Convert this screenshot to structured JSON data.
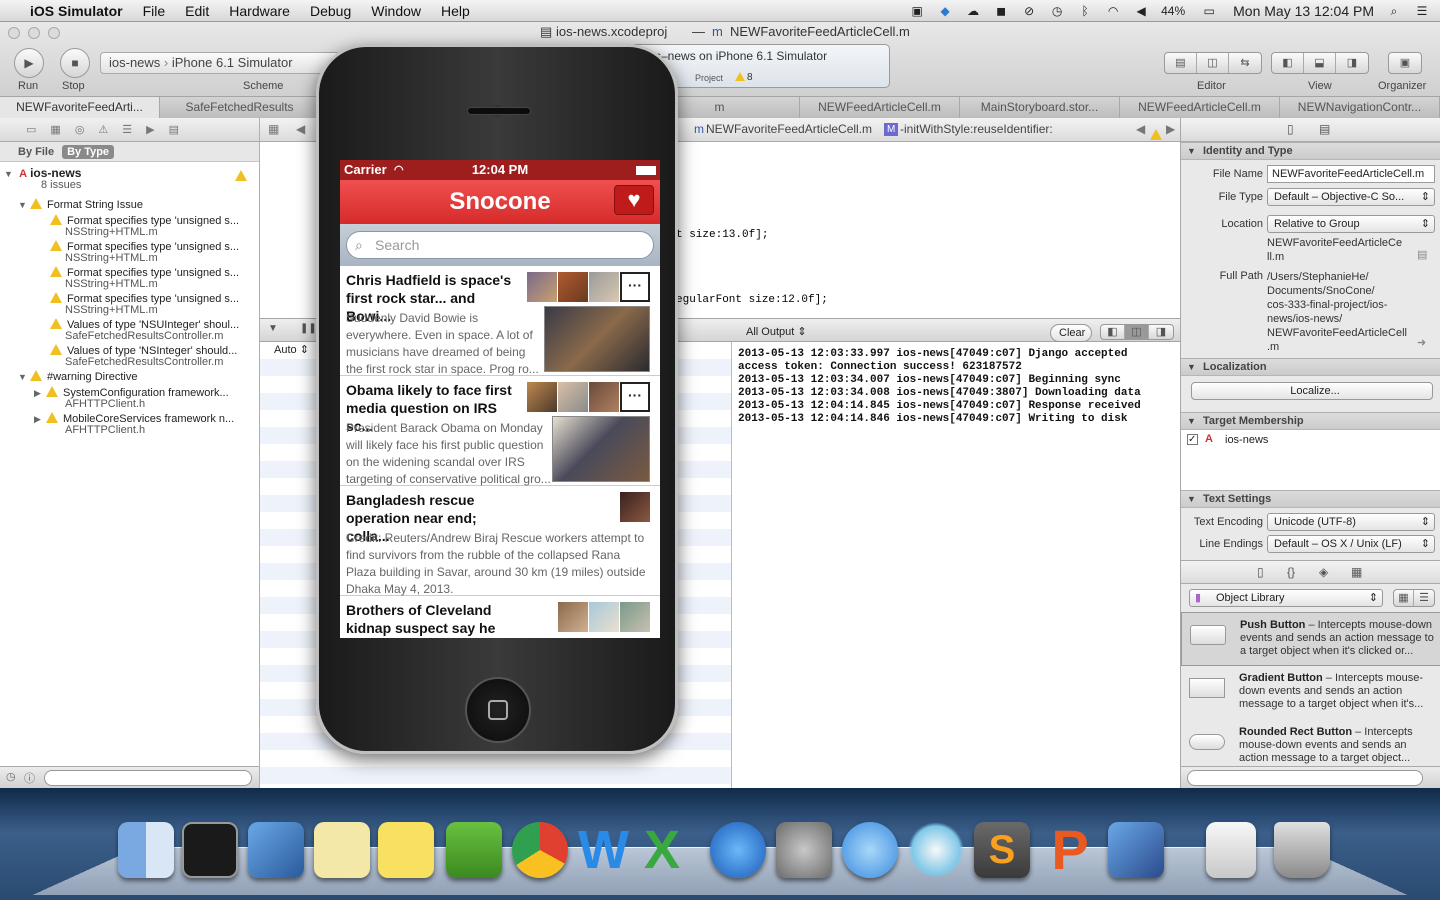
{
  "menubar": {
    "apple": "",
    "app_name": "iOS Simulator",
    "items": [
      "File",
      "Edit",
      "Hardware",
      "Debug",
      "Window",
      "Help"
    ],
    "battery": "44%",
    "clock": "Mon May 13  12:04 PM"
  },
  "window": {
    "title_left": "ios-news.xcodeproj",
    "title_sep": "—",
    "title_right": "NEWFavoriteFeedArticleCell.m",
    "run_label": "Run",
    "stop_label": "Stop",
    "scheme_project": "ios-news",
    "scheme_device": "iPhone 6.1 Simulator",
    "scheme_label": "Scheme",
    "activity_text": "s–news on iPhone 6.1 Simulator",
    "activity_project": "Project",
    "activity_warnings": "8",
    "editor_label": "Editor",
    "view_label": "View",
    "organizer_label": "Organizer"
  },
  "tabs": [
    "NEWFavoriteFeedArti...",
    "SafeFetchedResults",
    "",
    "",
    "m",
    "NEWFeedArticleCell.m",
    "MainStoryboard.stor...",
    "NEWFeedArticleCell.m",
    "NEWNavigationContr..."
  ],
  "navigator": {
    "by_file": "By File",
    "by_type": "By Type",
    "project": "ios-news",
    "project_sub": "8 issues",
    "group1": "Format String Issue",
    "group2": "#warning Directive",
    "issues": [
      {
        "title": "Format specifies type 'unsigned s...",
        "file": "NSString+HTML.m"
      },
      {
        "title": "Format specifies type 'unsigned s...",
        "file": "NSString+HTML.m"
      },
      {
        "title": "Format specifies type 'unsigned s...",
        "file": "NSString+HTML.m"
      },
      {
        "title": "Format specifies type 'unsigned s...",
        "file": "NSString+HTML.m"
      },
      {
        "title": "Values of type 'NSUInteger' shoul...",
        "file": "SafeFetchedResultsController.m"
      },
      {
        "title": "Values of type 'NSInteger' should...",
        "file": "SafeFetchedResultsController.m"
      }
    ],
    "directives": [
      {
        "title": "SystemConfiguration framework...",
        "file": "AFHTTPClient.h"
      },
      {
        "title": "MobileCoreServices framework n...",
        "file": "AFHTTPClient.h"
      }
    ]
  },
  "editor": {
    "jump_file": "NEWFavoriteFeedArticleCell.m",
    "jump_method": "-initWithStyle:reuseIdentifier:",
    "code1": "t size:13.0f];",
    "code2": "egularFont size:12.0f];",
    "auto_label": "Auto",
    "output_label": "All Output",
    "clear_label": "Clear",
    "console": "2013-05-13 12:03:33.997 ios-news[47049:c07] Django accepted\naccess token: Connection success! 623187572\n2013-05-13 12:03:34.007 ios-news[47049:c07] Beginning sync\n2013-05-13 12:03:34.008 ios-news[47049:3807] Downloading data\n2013-05-13 12:04:14.845 ios-news[47049:c07] Response received\n2013-05-13 12:04:14.846 ios-news[47049:c07] Writing to disk"
  },
  "inspector": {
    "identity_header": "Identity and Type",
    "file_name_label": "File Name",
    "file_name_value": "NEWFavoriteFeedArticleCell.m",
    "file_type_label": "File Type",
    "file_type_value": "Default – Objective-C So...",
    "location_label": "Location",
    "location_value": "Relative to Group",
    "location_path": "NEWFavoriteFeedArticleCe\nll.m",
    "full_path_label": "Full Path",
    "full_path_value": "/Users/StephanieHe/\nDocuments/SnoCone/\ncos-333-final-project/ios-\nnews/ios-news/\nNEWFavoriteFeedArticleCell\n.m",
    "localization_header": "Localization",
    "localize_button": "Localize...",
    "target_header": "Target Membership",
    "target_name": "ios-news",
    "text_settings_header": "Text Settings",
    "encoding_label": "Text Encoding",
    "encoding_value": "Unicode (UTF-8)",
    "line_endings_label": "Line Endings",
    "line_endings_value": "Default – OS X / Unix (LF)",
    "library_select": "Object Library",
    "library_items": [
      {
        "name": "Push Button",
        "desc": " – Intercepts mouse-down events and sends an action message to a target object when it's clicked or..."
      },
      {
        "name": "Gradient Button",
        "desc": " – Intercepts mouse-down events and sends an action message to a target object when it's..."
      },
      {
        "name": "Rounded Rect Button",
        "desc": " – Intercepts mouse-down events and sends an action message to a target object..."
      }
    ]
  },
  "simulator": {
    "carrier": "Carrier",
    "time": "12:04 PM",
    "app_title": "Snocone",
    "search_placeholder": "Search",
    "articles": [
      {
        "title": "Chris Hadfield is space's first rock star... and Bowi...",
        "snippet": "Suddenly David Bowie is\neverywhere. Even in space. A lot of\nmusicians have dreamed of being\nthe first rock star in space. Prog ro..."
      },
      {
        "title": "Obama likely to face first media question on IRS sc...",
        "snippet": "President Barack Obama on Monday\nwill likely face his first public question\non the widening scandal over IRS\ntargeting of conservative political gro..."
      },
      {
        "title": "Bangladesh rescue operation near end; colla...",
        "snippet": "Credit: Reuters/Andrew Biraj Rescue workers attempt to\nfind survivors from the rubble of the collapsed Rana\nPlaza building in Savar, around 30 km (19 miles) outside\nDhaka May 4, 2013."
      },
      {
        "title": "Brothers of Cleveland kidnap suspect say he wa...",
        "snippet": ""
      }
    ],
    "more_label": "···"
  },
  "colors": {
    "accent_red": "#d62a2a",
    "warning_yellow": "#f0c020"
  }
}
